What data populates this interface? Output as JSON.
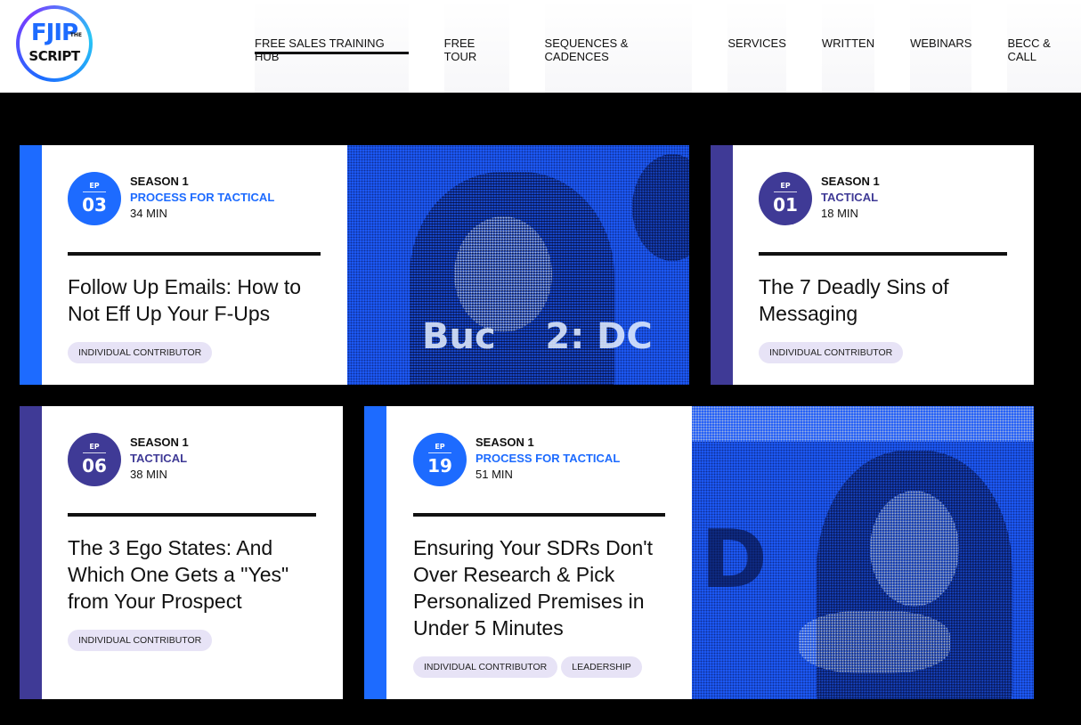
{
  "logo": {
    "top": "FJIP",
    "the": "THE",
    "bottom": "SCRIPT"
  },
  "nav": [
    {
      "label": "FREE SALES TRAINING HUB",
      "active": true
    },
    {
      "label": "FREE TOUR"
    },
    {
      "label": "SEQUENCES & CADENCES"
    },
    {
      "label": "SERVICES"
    },
    {
      "label": "WRITTEN"
    },
    {
      "label": "WEBINARS"
    },
    {
      "label": "BECC & CALL"
    }
  ],
  "cards": [
    {
      "ep_label": "EP",
      "ep": "03",
      "season": "SEASON 1",
      "category": "PROCESS FOR TACTICAL",
      "duration": "34 MIN",
      "title": "Follow Up Emails: How to Not Eff Up Your F-Ups",
      "tags": [
        "INDIVIDUAL CONTRIBUTOR"
      ],
      "photo_text": "Buc    2: DC"
    },
    {
      "ep_label": "EP",
      "ep": "01",
      "season": "SEASON 1",
      "category": "TACTICAL",
      "duration": "18 MIN",
      "title": "The 7 Deadly Sins of Messaging",
      "tags": [
        "INDIVIDUAL CONTRIBUTOR"
      ]
    },
    {
      "ep_label": "EP",
      "ep": "06",
      "season": "SEASON 1",
      "category": "TACTICAL",
      "duration": "38 MIN",
      "title": "The 3 Ego States: And Which One Gets a \"Yes\" from Your Prospect",
      "tags": [
        "INDIVIDUAL CONTRIBUTOR"
      ]
    },
    {
      "ep_label": "EP",
      "ep": "19",
      "season": "SEASON 1",
      "category": "PROCESS FOR TACTICAL",
      "duration": "51 MIN",
      "title": "Ensuring Your SDRs Don't Over Research & Pick Personalized Premises in Under 5 Minutes",
      "tags": [
        "INDIVIDUAL CONTRIBUTOR",
        "LEADERSHIP"
      ],
      "photo_text": "D"
    }
  ],
  "colors": {
    "blue": "#1d6bff",
    "purple": "#3f3a96",
    "tag_bg": "#e7e3f6"
  }
}
